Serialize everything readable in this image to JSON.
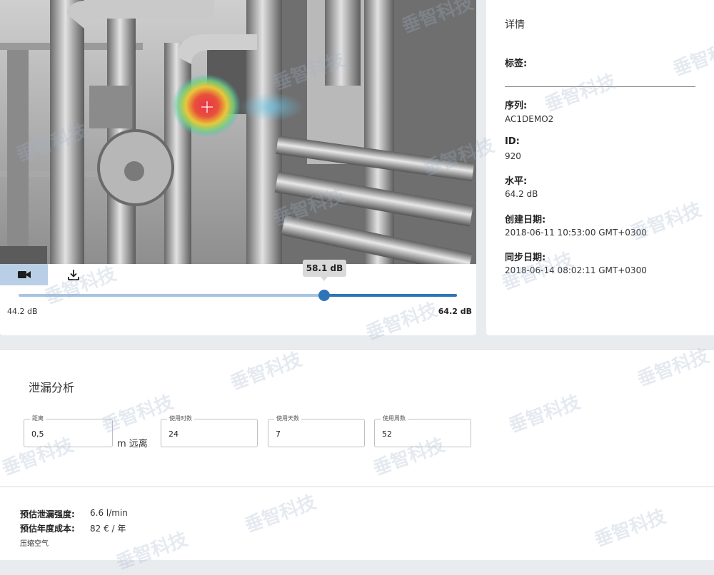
{
  "viewer": {
    "tooltip_value": "58.1 dB",
    "slider_min": "44.2 dB",
    "slider_max": "64.2 dB",
    "slider_value_db": 58.1,
    "camera_icon": "video-camera-icon",
    "download_icon": "download-icon"
  },
  "details": {
    "title": "详情",
    "tags_label": "标签:",
    "sequence_label": "序列:",
    "sequence_value": "AC1DEMO2",
    "id_label": "ID:",
    "id_value": "920",
    "level_label": "水平:",
    "level_value": "64.2 dB",
    "created_label": "创建日期:",
    "created_value": "2018-06-11 10:53:00 GMT+0300",
    "sync_label": "同步日期:",
    "sync_value": "2018-06-14 08:02:11 GMT+0300"
  },
  "leak": {
    "title": "泄漏分析",
    "distance_label": "距离",
    "distance_value": "0,5",
    "distance_unit": "m 远离",
    "hours_label": "使用时数",
    "hours_value": "24",
    "days_label": "使用天数",
    "days_value": "7",
    "weeks_label": "使用周数",
    "weeks_value": "52",
    "strength_label": "预估泄漏强度:",
    "strength_value": "6.6 l/min",
    "cost_label": "预估年度成本:",
    "cost_value": "82 € / 年",
    "gas_type": "压缩空气"
  },
  "watermark": "垂智科技",
  "colors": {
    "accent": "#2f74b8",
    "accent_light": "#a7c3e2",
    "camera_button_bg": "#b9cfe6"
  }
}
